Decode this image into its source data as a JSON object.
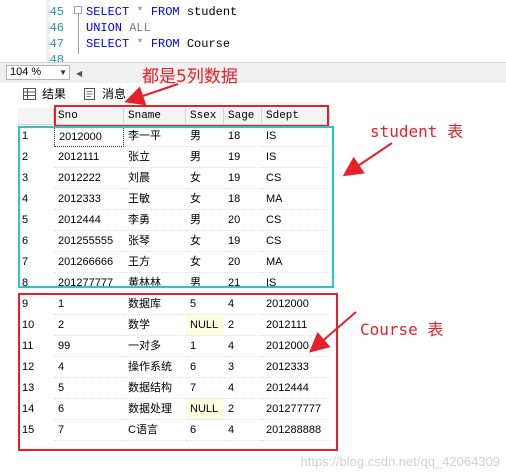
{
  "editor": {
    "lines": [
      {
        "num": "45",
        "tokens": [
          {
            "t": "SELECT",
            "c": "kw"
          },
          {
            "t": " * ",
            "c": "gr"
          },
          {
            "t": "FROM",
            "c": "kw"
          },
          {
            "t": " student",
            "c": ""
          }
        ]
      },
      {
        "num": "46",
        "tokens": [
          {
            "t": "UNION",
            "c": "kw"
          },
          {
            "t": " ",
            "c": ""
          },
          {
            "t": "ALL",
            "c": "gr"
          }
        ]
      },
      {
        "num": "47",
        "tokens": [
          {
            "t": "SELECT",
            "c": "kw"
          },
          {
            "t": " * ",
            "c": "gr"
          },
          {
            "t": "FROM",
            "c": "kw"
          },
          {
            "t": " Course",
            "c": ""
          }
        ]
      },
      {
        "num": "48",
        "tokens": []
      }
    ]
  },
  "status": {
    "zoom": "104 %"
  },
  "tabs": {
    "results": "结果",
    "messages": "消息"
  },
  "grid": {
    "columns": [
      "Sno",
      "Sname",
      "Ssex",
      "Sage",
      "Sdept"
    ],
    "rows": [
      [
        "1",
        "2012000",
        "李一平",
        "男",
        "18",
        "IS"
      ],
      [
        "2",
        "2012111",
        "张立",
        "男",
        "19",
        "IS"
      ],
      [
        "3",
        "2012222",
        "刘晨",
        "女",
        "19",
        "CS"
      ],
      [
        "4",
        "2012333",
        "王敏",
        "女",
        "18",
        "MA"
      ],
      [
        "5",
        "2012444",
        "李勇",
        "男",
        "20",
        "CS"
      ],
      [
        "6",
        "201255555",
        "张琴",
        "女",
        "19",
        "CS"
      ],
      [
        "7",
        "201266666",
        "王方",
        "女",
        "20",
        "MA"
      ],
      [
        "8",
        "201277777",
        "黄林林",
        "男",
        "21",
        "IS"
      ],
      [
        "9",
        "1",
        "数据库",
        "5",
        "4",
        "2012000"
      ],
      [
        "10",
        "2",
        "数学",
        "NULL",
        "2",
        "2012111"
      ],
      [
        "11",
        "99",
        "一对多",
        "1",
        "4",
        "2012000"
      ],
      [
        "12",
        "4",
        "操作系统",
        "6",
        "3",
        "2012333"
      ],
      [
        "13",
        "5",
        "数据结构",
        "7",
        "4",
        "2012444"
      ],
      [
        "14",
        "6",
        "数据处理",
        "NULL",
        "2",
        "201277777"
      ],
      [
        "15",
        "7",
        "C语言",
        "6",
        "4",
        "201288888"
      ]
    ]
  },
  "annotations": {
    "columns_note": "都是5列数据",
    "student_label": "student 表",
    "course_label": "Course 表",
    "color": "#e8202a",
    "student_box_color": "#2ec4c4"
  },
  "watermark": "https://blog.csdn.net/qq_42064309"
}
